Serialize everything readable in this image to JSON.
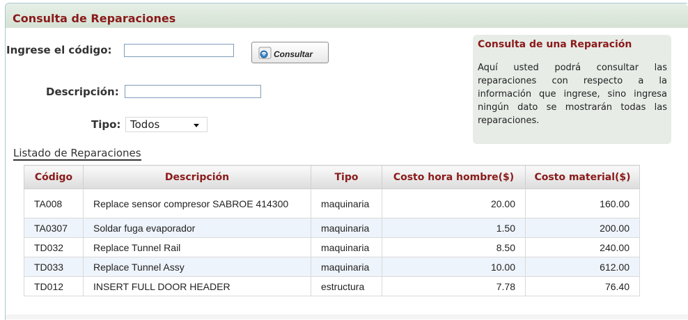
{
  "page": {
    "title": "Consulta de Reparaciones"
  },
  "form": {
    "codigo_label": "Ingrese el código:",
    "codigo_value": "",
    "consultar_label": "Consultar",
    "descripcion_label": "Descripción:",
    "descripcion_value": "",
    "tipo_label": "Tipo:",
    "tipo_selected": "Todos"
  },
  "info": {
    "title": "Consulta de una Reparación",
    "body": "Aquí usted podrá consultar las reparaciones con respecto a la información que ingrese, sino ingresa ningún dato se mostrarán todas las reparaciones."
  },
  "listado": {
    "title": "Listado de Reparaciones",
    "columns": [
      "Código",
      "Descripción",
      "Tipo",
      "Costo hora hombre($)",
      "Costo material($)"
    ],
    "rows": [
      [
        "TA008",
        "Replace sensor compresor SABROE 414300",
        "maquinaria",
        "20.00",
        "160.00"
      ],
      [
        "TA0307",
        "Soldar fuga evaporador",
        "maquinaria",
        "1.50",
        "200.00"
      ],
      [
        "TD032",
        "Replace Tunnel Rail",
        "maquinaria",
        "8.50",
        "240.00"
      ],
      [
        "TD033",
        "Replace Tunnel Assy",
        "maquinaria",
        "10.00",
        "612.00"
      ],
      [
        "TD012",
        "INSERT FULL DOOR HEADER",
        "estructura",
        "7.78",
        "76.40"
      ]
    ]
  },
  "colors": {
    "accent": "#8b1a1a",
    "header_bg": "#d4e2d4",
    "info_bg": "#e7ece7",
    "row_alt": "#eef4fb"
  },
  "icons": {
    "consultar": "search-globe-icon",
    "tipo_dropdown": "chevron-down-icon"
  }
}
